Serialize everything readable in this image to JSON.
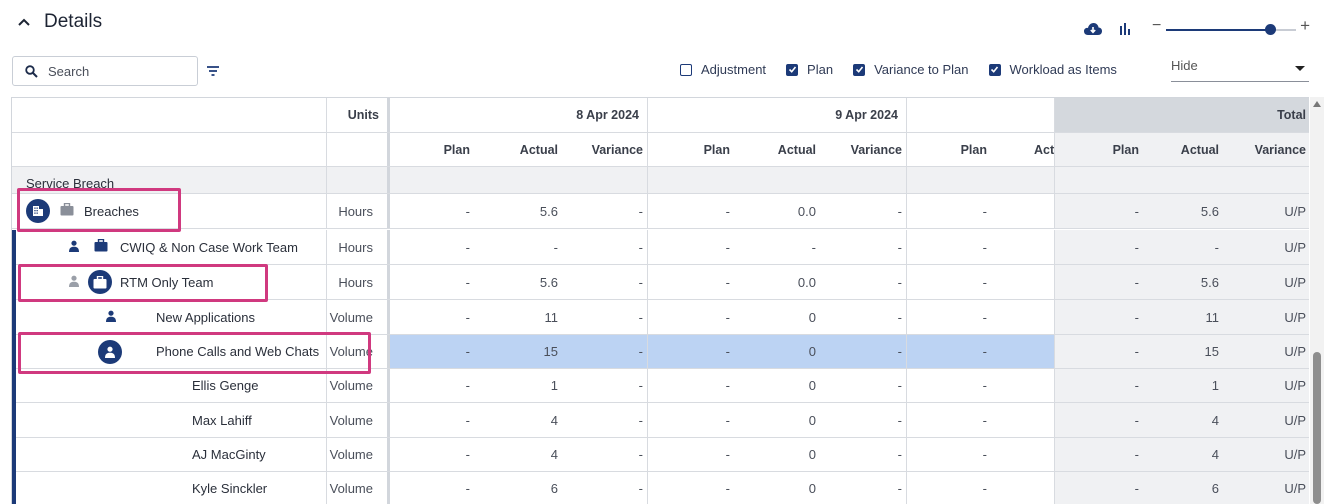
{
  "header": {
    "title": "Details"
  },
  "toolbar": {
    "search_placeholder": "Search",
    "checkboxes": [
      {
        "label": "Adjustment",
        "checked": false
      },
      {
        "label": "Plan",
        "checked": true
      },
      {
        "label": "Variance to Plan",
        "checked": true
      },
      {
        "label": "Workload as Items",
        "checked": true
      }
    ],
    "hide_select": {
      "value": "Hide"
    },
    "zoom_level": 0.8
  },
  "grid": {
    "units_header": "Units",
    "date_headers": [
      "8 Apr 2024",
      "9 Apr 2024"
    ],
    "total_header": "Total",
    "sub_headers": {
      "plan": "Plan",
      "actual": "Actual",
      "variance": "Variance",
      "act_cut": "Act"
    },
    "group_label": "Service Breach",
    "rows": [
      {
        "name": "Breaches",
        "units": "Hours",
        "d1": [
          "-",
          "5.6",
          "-"
        ],
        "d2": [
          "-",
          "0.0",
          "-"
        ],
        "d3": [
          "-"
        ],
        "total": [
          "-",
          "5.6",
          "U/P"
        ]
      },
      {
        "name": "CWIQ & Non Case Work Team",
        "units": "Hours",
        "d1": [
          "-",
          "-",
          "-"
        ],
        "d2": [
          "-",
          "-",
          "-"
        ],
        "d3": [
          "-"
        ],
        "total": [
          "-",
          "-",
          "U/P"
        ]
      },
      {
        "name": "RTM Only Team",
        "units": "Hours",
        "d1": [
          "-",
          "5.6",
          "-"
        ],
        "d2": [
          "-",
          "0.0",
          "-"
        ],
        "d3": [
          "-"
        ],
        "total": [
          "-",
          "5.6",
          "U/P"
        ]
      },
      {
        "name": "New Applications",
        "units": "Volume",
        "d1": [
          "-",
          "11",
          "-"
        ],
        "d2": [
          "-",
          "0",
          "-"
        ],
        "d3": [
          "-"
        ],
        "total": [
          "-",
          "11",
          "U/P"
        ]
      },
      {
        "name": "Phone Calls and Web Chats",
        "units": "Volume",
        "d1": [
          "-",
          "15",
          "-"
        ],
        "d2": [
          "-",
          "0",
          "-"
        ],
        "d3": [
          "-"
        ],
        "total": [
          "-",
          "15",
          "U/P"
        ]
      },
      {
        "name": "Ellis Genge",
        "units": "Volume",
        "d1": [
          "-",
          "1",
          "-"
        ],
        "d2": [
          "-",
          "0",
          "-"
        ],
        "d3": [
          "-"
        ],
        "total": [
          "-",
          "1",
          "U/P"
        ]
      },
      {
        "name": "Max Lahiff",
        "units": "Volume",
        "d1": [
          "-",
          "4",
          "-"
        ],
        "d2": [
          "-",
          "0",
          "-"
        ],
        "d3": [
          "-"
        ],
        "total": [
          "-",
          "4",
          "U/P"
        ]
      },
      {
        "name": "AJ MacGinty",
        "units": "Volume",
        "d1": [
          "-",
          "4",
          "-"
        ],
        "d2": [
          "-",
          "0",
          "-"
        ],
        "d3": [
          "-"
        ],
        "total": [
          "-",
          "4",
          "U/P"
        ]
      },
      {
        "name": "Kyle Sinckler",
        "units": "Volume",
        "d1": [
          "-",
          "6",
          "-"
        ],
        "d2": [
          "-",
          "0",
          "-"
        ],
        "d3": [
          "-"
        ],
        "total": [
          "-",
          "6",
          "U/P"
        ]
      }
    ]
  },
  "colors": {
    "accent": "#1c3a78",
    "highlight": "#d0397f",
    "selected_row": "#bcd3f3"
  }
}
